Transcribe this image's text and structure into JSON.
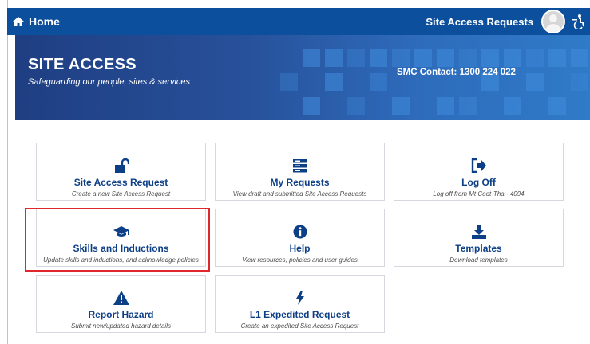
{
  "nav": {
    "home_label": "Home",
    "home_icon": "home-icon",
    "requests_link": "Site Access Requests",
    "avatar_icon": "user-avatar-icon",
    "tool_icon": "accessibility-icon",
    "bar_color": "#0c4f9d"
  },
  "banner": {
    "title": "SITE ACCESS",
    "subtitle": "Safeguarding our people, sites & services",
    "contact": "SMC Contact: 1300 224 022"
  },
  "cards": [
    {
      "title": "Site Access Request",
      "desc": "Create a new Site Access Request",
      "icon": "unlock-icon"
    },
    {
      "title": "My Requests",
      "desc": "View draft and submitted Site Access Requests",
      "icon": "server-list-icon"
    },
    {
      "title": "Log Off",
      "desc": "Log off from Mt Coot-Tha - 4094",
      "icon": "sign-out-icon"
    },
    {
      "title": "Skills and Inductions",
      "desc": "Update skills and inductions, and acknowledge policies",
      "icon": "graduation-cap-icon"
    },
    {
      "title": "Help",
      "desc": "View resources, policies and user guides",
      "icon": "info-circle-icon"
    },
    {
      "title": "Templates",
      "desc": "Download templates",
      "icon": "download-icon"
    },
    {
      "title": "Report Hazard",
      "desc": "Submit new/updated hazard details",
      "icon": "warning-triangle-icon"
    },
    {
      "title": "L1 Expedited Request",
      "desc": "Create an expedited Site Access Request",
      "icon": "lightning-bolt-icon"
    }
  ],
  "colors": {
    "card_title": "#0d3f86",
    "highlight_border": "#e0272d"
  }
}
